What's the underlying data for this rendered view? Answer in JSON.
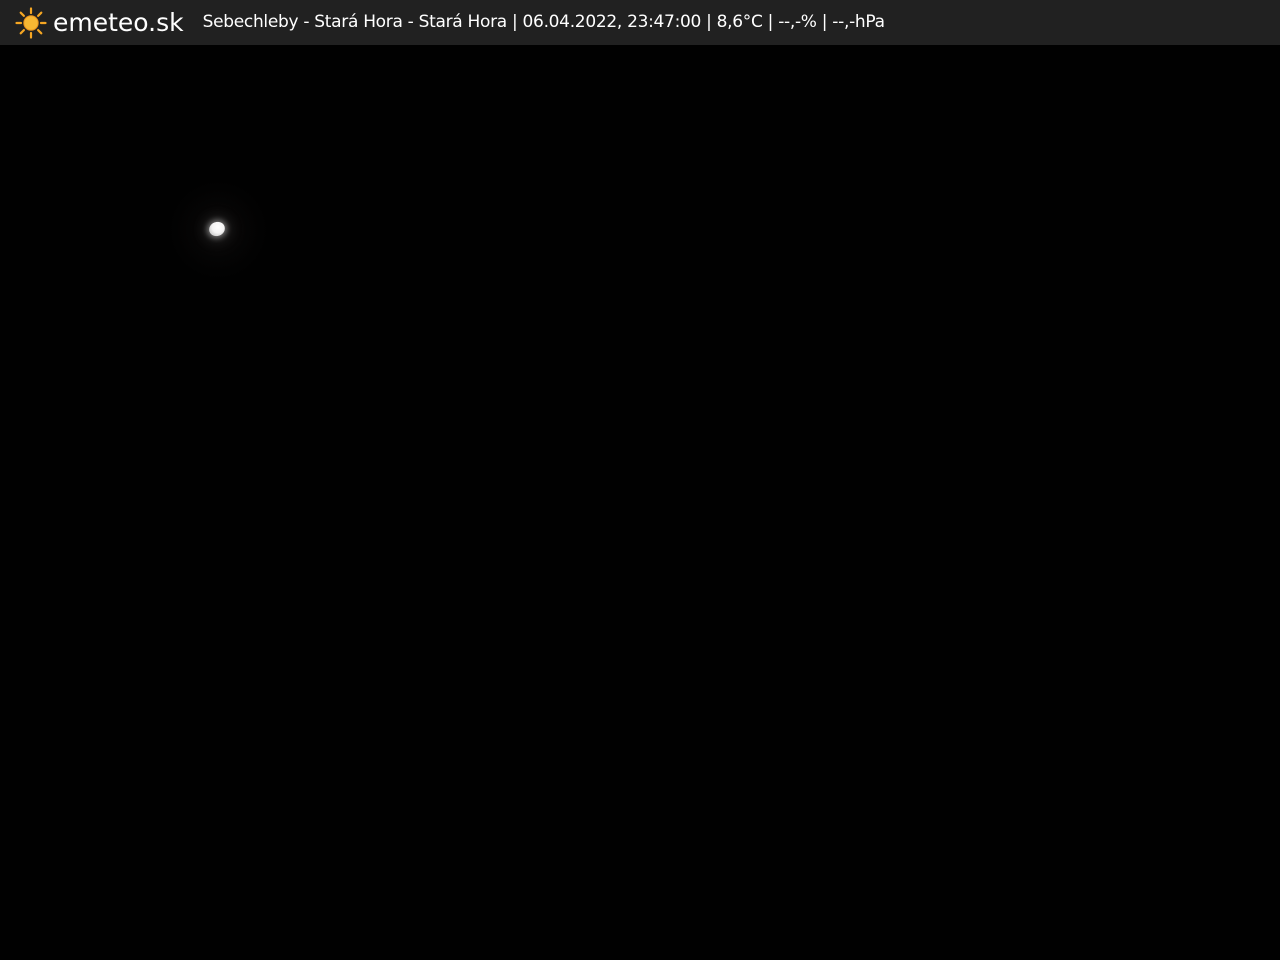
{
  "header": {
    "brand": "emeteo.sk",
    "caption": "Sebechleby - Stará Hora - Stará Hora | 06.04.2022, 23:47:00 | 8,6°C | --,-% | --,-hPa",
    "logo_icon": "sun-icon",
    "background_color": "#212121",
    "accent_color": "#f5a623"
  },
  "scene": {
    "background_color": "#010101"
  }
}
